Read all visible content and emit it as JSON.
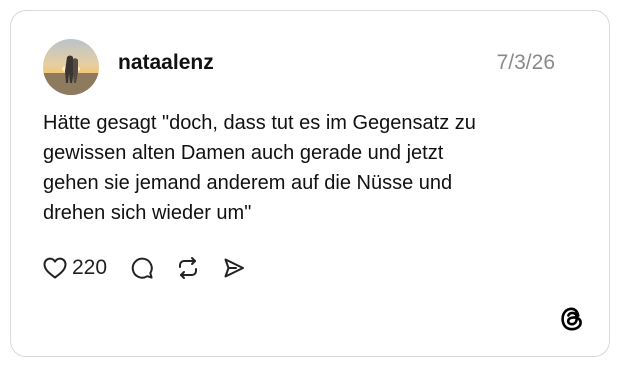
{
  "post": {
    "username": "nataalenz",
    "date": "7/3/26",
    "text": "Hätte gesagt \"doch, dass tut es im Gegensatz zu\ngewissen alten Damen auch gerade und jetzt\ngehen sie jemand anderem auf die Nüsse und\ndrehen sich wieder um\"",
    "like_count": "220"
  },
  "icons": {
    "avatar": "profile-photo",
    "like": "heart-icon",
    "reply": "comment-bubble-icon",
    "repost": "repost-arrows-icon",
    "share": "send-paper-plane-icon",
    "brand": "threads-logo"
  },
  "colors": {
    "border": "#d9d9d9",
    "text": "#111111",
    "muted": "#8a8a8a"
  }
}
